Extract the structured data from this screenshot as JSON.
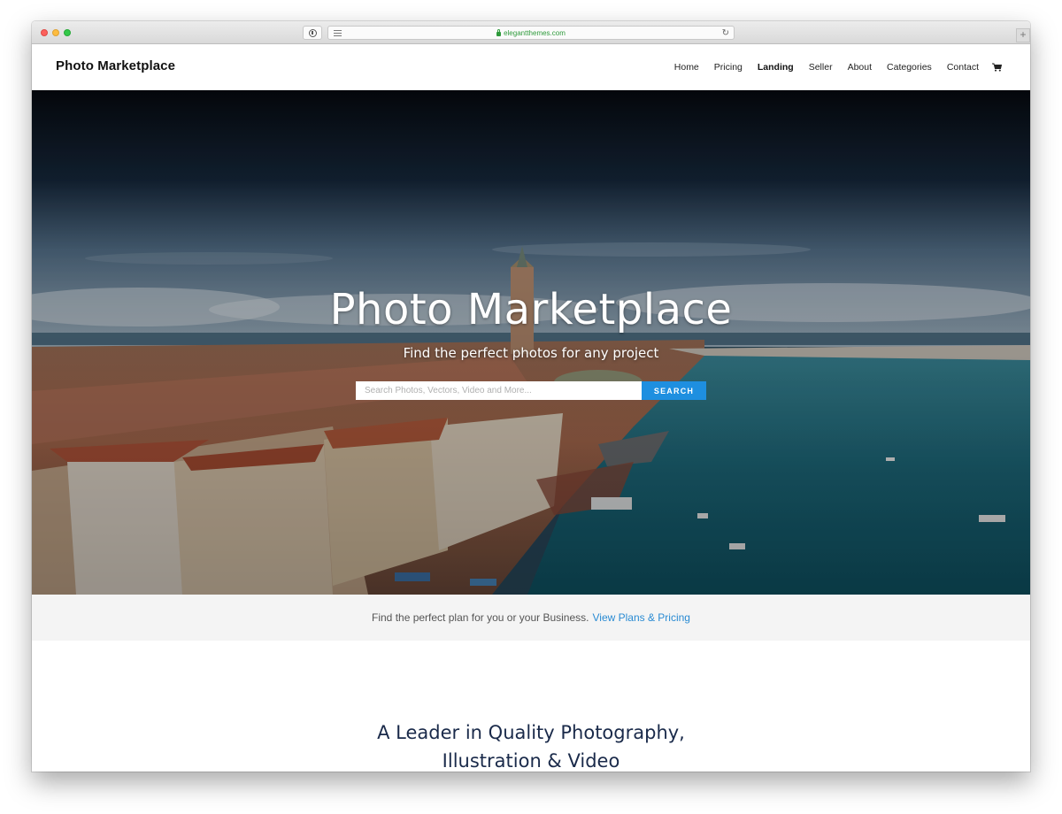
{
  "browser": {
    "url": "elegantthemes.com",
    "new_tab": "+"
  },
  "site": {
    "logo": "Photo Marketplace"
  },
  "nav": {
    "items": [
      {
        "label": "Home"
      },
      {
        "label": "Pricing"
      },
      {
        "label": "Landing"
      },
      {
        "label": "Seller"
      },
      {
        "label": "About"
      },
      {
        "label": "Categories"
      },
      {
        "label": "Contact"
      }
    ],
    "active": "Landing",
    "cart_icon": "cart-icon"
  },
  "hero": {
    "title": "Photo Marketplace",
    "subtitle": "Find the perfect photos for any project",
    "search_placeholder": "Search Photos, Vectors, Video and More...",
    "search_button": "SEARCH"
  },
  "plans": {
    "text": "Find the perfect plan for you or your Business.",
    "link": "View Plans & Pricing",
    "link_color": "#2a8bd3"
  },
  "section": {
    "heading_line1": "A Leader in Quality Photography,",
    "heading_line2": "Illustration & Video"
  },
  "colors": {
    "accent": "#1e8fe0",
    "heading": "#1a2a4a"
  }
}
